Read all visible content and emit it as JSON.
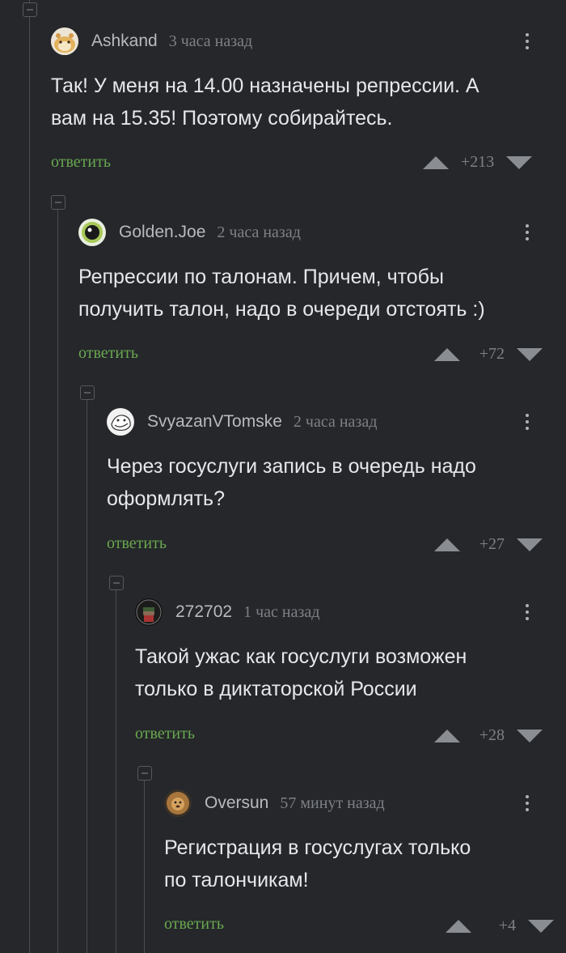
{
  "colors": {
    "background": "#25272b",
    "text": "#e6e7e9",
    "username": "#b8babd",
    "meta": "#7d8085",
    "reply_link": "#6aa84f",
    "thread_line": "#4a4d52"
  },
  "comments": [
    {
      "username": "Ashkand",
      "time": "3 часа назад",
      "text": "Так! У меня на 14.00 назначены репрессии. А\nвам на 15.35! Поэтому собирайтесь.",
      "reply_label": "ответить",
      "score": "+213",
      "avatar_icon": "hamster-avatar"
    },
    {
      "username": "Golden.Joe",
      "time": "2 часа назад",
      "text": "Репрессии по талонам. Причем, чтобы\nполучить талон, надо в очереди отстоять :)",
      "reply_label": "ответить",
      "score": "+72",
      "avatar_icon": "eye-avatar"
    },
    {
      "username": "SvyazanVTomske",
      "time": "2 часа назад",
      "text": "Через госуслуги запись в очередь надо\nоформлять?",
      "reply_label": "ответить",
      "score": "+27",
      "avatar_icon": "troll-face-avatar"
    },
    {
      "username": "272702",
      "time": "1 час назад",
      "text": "Такой ужас как госуслуги возможен\nтолько в диктаторской России",
      "reply_label": "ответить",
      "score": "+28",
      "avatar_icon": "soldier-badge-avatar"
    },
    {
      "username": "Oversun",
      "time": "57 минут назад",
      "text": "Регистрация в госуслугах только\nпо талончикам!",
      "reply_label": "ответить",
      "score": "+4",
      "avatar_icon": "lion-avatar"
    }
  ]
}
